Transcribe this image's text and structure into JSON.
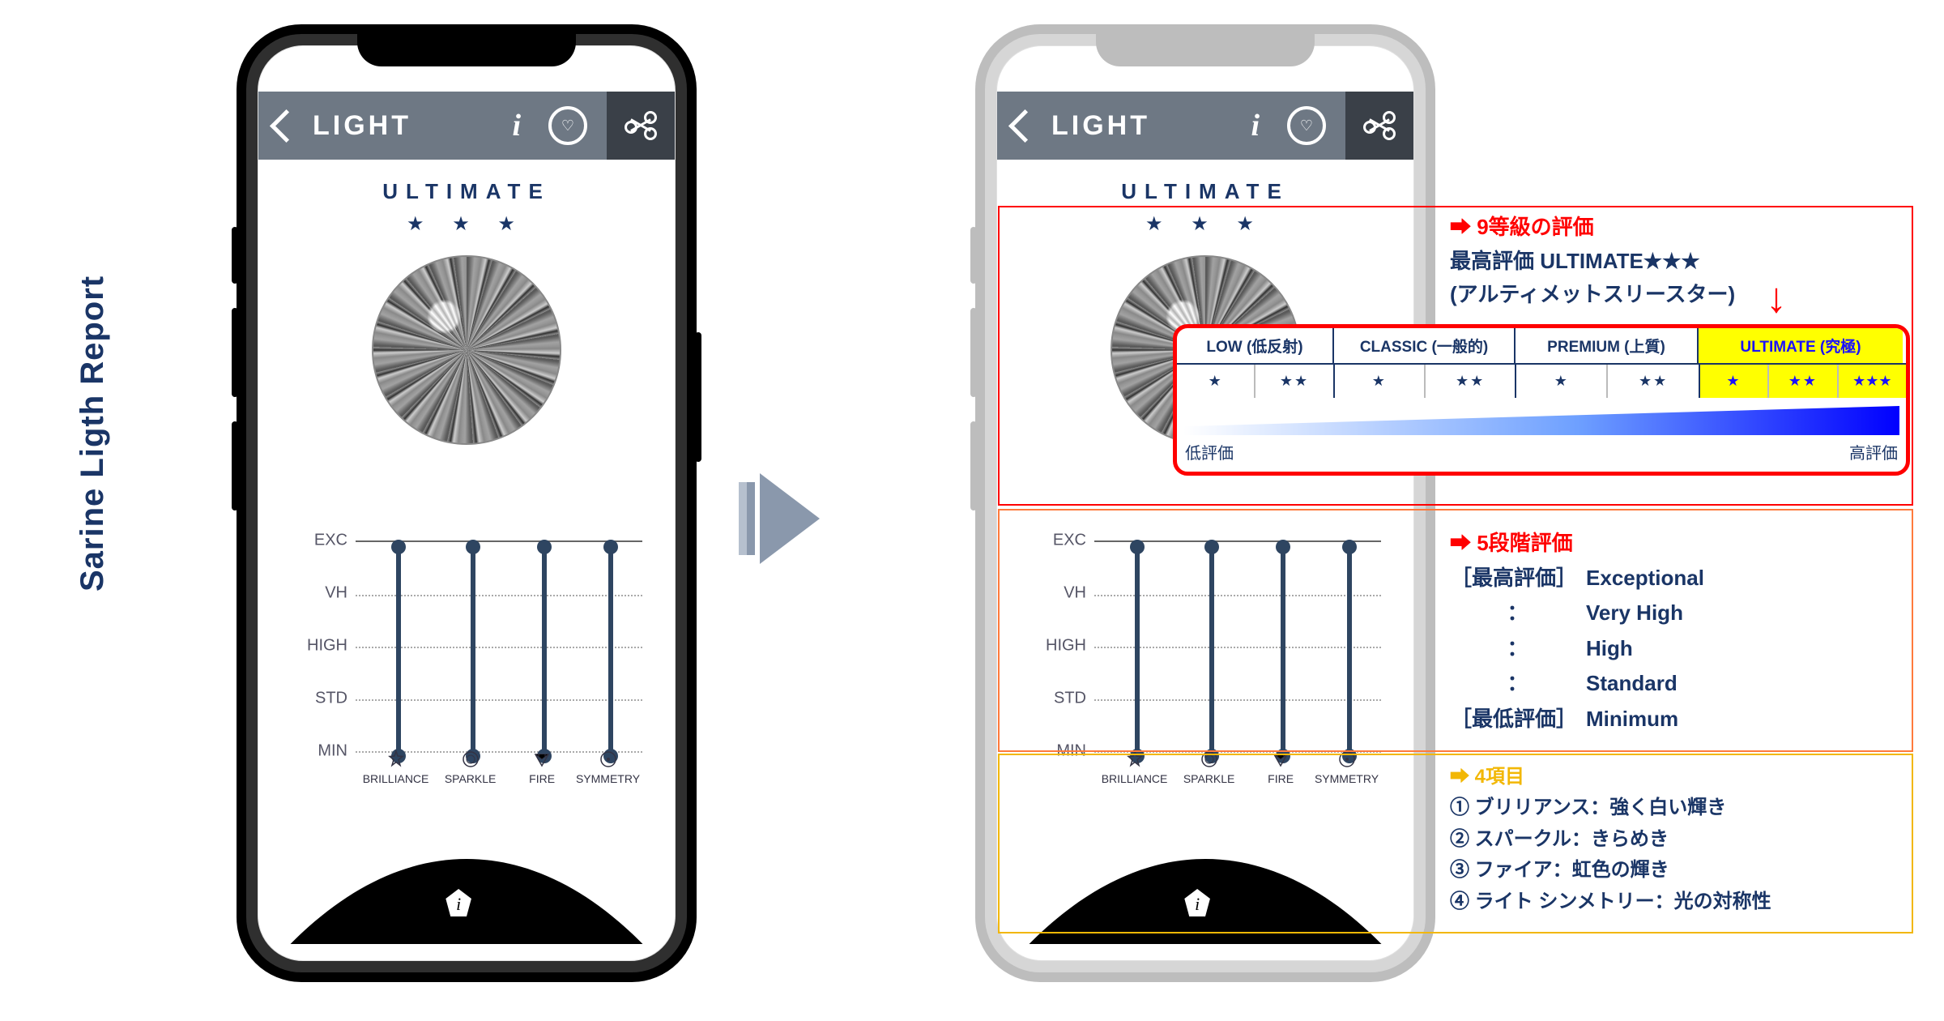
{
  "side_title": "Sarine Ligth Report",
  "topbar": {
    "title": "LIGHT"
  },
  "grade": {
    "title": "ULTIMATE",
    "stars": "★ ★ ★"
  },
  "chart": {
    "ylabels": [
      "EXC",
      "VH",
      "HIGH",
      "STD",
      "MIN"
    ],
    "xlabels": [
      "BRILLIANCE",
      "SPARKLE",
      "FIRE",
      "SYMMETRY"
    ]
  },
  "callout9": {
    "head": "➡ 9等級の評価",
    "l1": "最高評価 ULTIMATE★★★",
    "l2": "(アルティメットスリースター)"
  },
  "ratings": {
    "groups": [
      {
        "label": "LOW (低反射)",
        "stars": [
          "★",
          "★★"
        ]
      },
      {
        "label": "CLASSIC (一般的)",
        "stars": [
          "★",
          "★★"
        ]
      },
      {
        "label": "PREMIUM (上質)",
        "stars": [
          "★",
          "★★"
        ]
      },
      {
        "label": "ULTIMATE (究極)",
        "stars": [
          "★",
          "★★",
          "★★★"
        ],
        "ult": true
      }
    ],
    "low": "低評価",
    "high": "高評価"
  },
  "callout5": {
    "head": "➡ 5段階評価",
    "rows": [
      {
        "k": "［最高評価］",
        "v": "Exceptional"
      },
      {
        "k": "：",
        "v": "Very High"
      },
      {
        "k": "：",
        "v": "High"
      },
      {
        "k": "：",
        "v": "Standard"
      },
      {
        "k": "［最低評価］",
        "v": "Minimum"
      }
    ]
  },
  "callout4": {
    "head": "➡ 4項目",
    "rows": [
      "① ブリリアンス：強く白い輝き",
      "② スパークル：きらめき",
      "③ ファイア：虹色の輝き",
      "④ ライト シンメトリー：光の対称性"
    ]
  }
}
